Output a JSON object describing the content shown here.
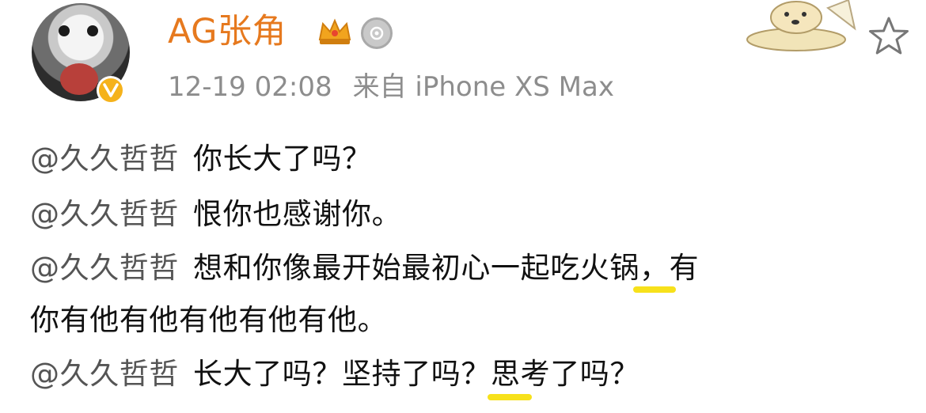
{
  "user": {
    "name": "AG张角",
    "timestamp": "12-19 02:08",
    "source": "来自 iPhone XS Max",
    "avatar_icon": "avatar-image",
    "verified_badge_icon": "verified-v-badge",
    "crown_icon": "crown-vip-icon",
    "level_icon": "level-medal-icon"
  },
  "decorations": {
    "sticker": "cartoon-dog-sticker",
    "favorite_icon": "star-outline-icon"
  },
  "post": {
    "lines": [
      {
        "mention": "@久久哲哲",
        "text": "你长大了吗？"
      },
      {
        "mention": "@久久哲哲",
        "text": "恨你也感谢你。"
      },
      {
        "mention": "@久久哲哲",
        "text": "想和你像最开始最初心一起吃火锅，有"
      },
      {
        "mention": "",
        "text": "你有他有他有他有他有他。"
      },
      {
        "mention": "@久久哲哲",
        "text": "长大了吗？坚持了吗？思考了吗？"
      }
    ]
  },
  "colors": {
    "name": "#e6791e",
    "meta": "#8d8d8d",
    "text": "#111111",
    "highlight": "#f7e11b",
    "badge": "#f5b21b"
  }
}
